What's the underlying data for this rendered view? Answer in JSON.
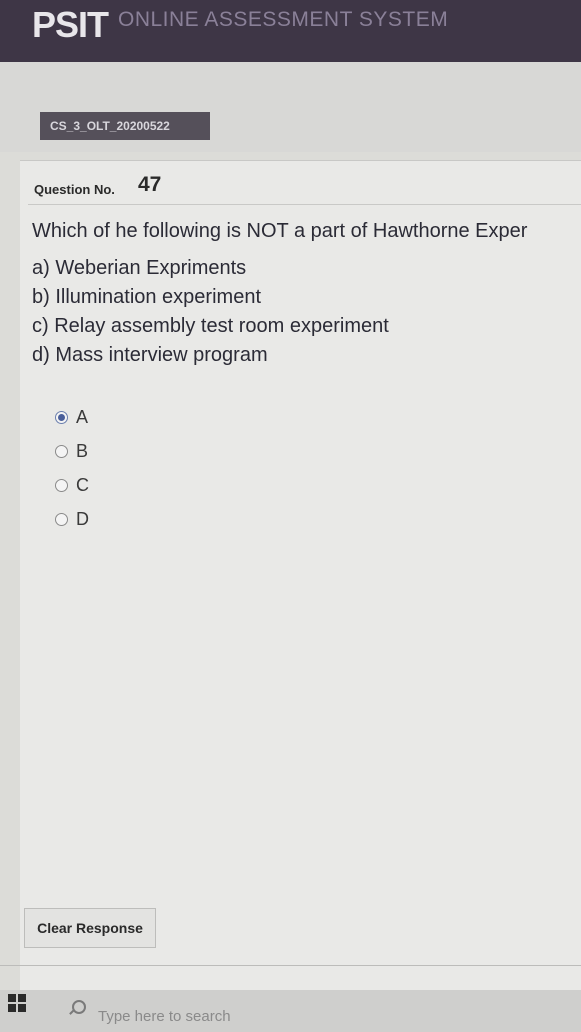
{
  "header": {
    "brand": "PSIT",
    "system_title": "ONLINE ASSESSMENT SYSTEM"
  },
  "test": {
    "code": "CS_3_OLT_20200522"
  },
  "question": {
    "number_label": "Question No.",
    "number": "47",
    "text": "Which of he following is NOT a part of Hawthorne Exper",
    "choices": [
      "a) Weberian Expriments",
      "b) Illumination experiment",
      "c) Relay assembly test room experiment",
      "d) Mass interview program"
    ]
  },
  "answer_options": [
    {
      "label": "A",
      "selected": true
    },
    {
      "label": "B",
      "selected": false
    },
    {
      "label": "C",
      "selected": false
    },
    {
      "label": "D",
      "selected": false
    }
  ],
  "actions": {
    "clear_response": "Clear Response"
  },
  "taskbar": {
    "search_placeholder": "Type here to search"
  }
}
